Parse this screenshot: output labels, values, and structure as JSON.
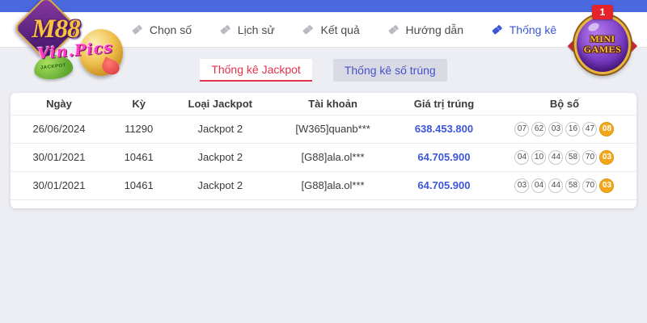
{
  "colors": {
    "topbar_blue": "#4b69de",
    "active_blue": "#3c55d8",
    "value_blue": "#3d55d8",
    "tab_red": "#e2334b",
    "ball_orange": "#f2a71b"
  },
  "logo": {
    "brand": "M88",
    "subbrand": "Vin.Pics",
    "ribbon": "JACKPOT"
  },
  "nav": {
    "items": [
      {
        "label": "Chọn số",
        "active": false
      },
      {
        "label": "Lịch sử",
        "active": false
      },
      {
        "label": "Kết quả",
        "active": false
      },
      {
        "label": "Hướng dẫn",
        "active": false
      },
      {
        "label": "Thống kê",
        "active": true
      }
    ]
  },
  "minigames": {
    "badge_count": "1",
    "line1": "MINI",
    "line2": "GAMES"
  },
  "subtabs": [
    {
      "label": "Thống kê Jackpot",
      "active": true
    },
    {
      "label": "Thống kê số trúng",
      "active": false
    }
  ],
  "table": {
    "columns": [
      "Ngày",
      "Kỳ",
      "Loại Jackpot",
      "Tài khoản",
      "Giá trị trúng",
      "Bộ số"
    ],
    "rows": [
      {
        "ngay": "26/06/2024",
        "ky": "11290",
        "loai": "Jackpot 2",
        "taikhoan": "[W365]quanb***",
        "giatri": "638.453.800",
        "balls": [
          "07",
          "62",
          "03",
          "16",
          "47"
        ],
        "bonus": "08"
      },
      {
        "ngay": "30/01/2021",
        "ky": "10461",
        "loai": "Jackpot 2",
        "taikhoan": "[G88]ala.ol***",
        "giatri": "64.705.900",
        "balls": [
          "04",
          "10",
          "44",
          "58",
          "70"
        ],
        "bonus": "03"
      },
      {
        "ngay": "30/01/2021",
        "ky": "10461",
        "loai": "Jackpot 2",
        "taikhoan": "[G88]ala.ol***",
        "giatri": "64.705.900",
        "balls": [
          "03",
          "04",
          "44",
          "58",
          "70"
        ],
        "bonus": "03"
      }
    ]
  }
}
